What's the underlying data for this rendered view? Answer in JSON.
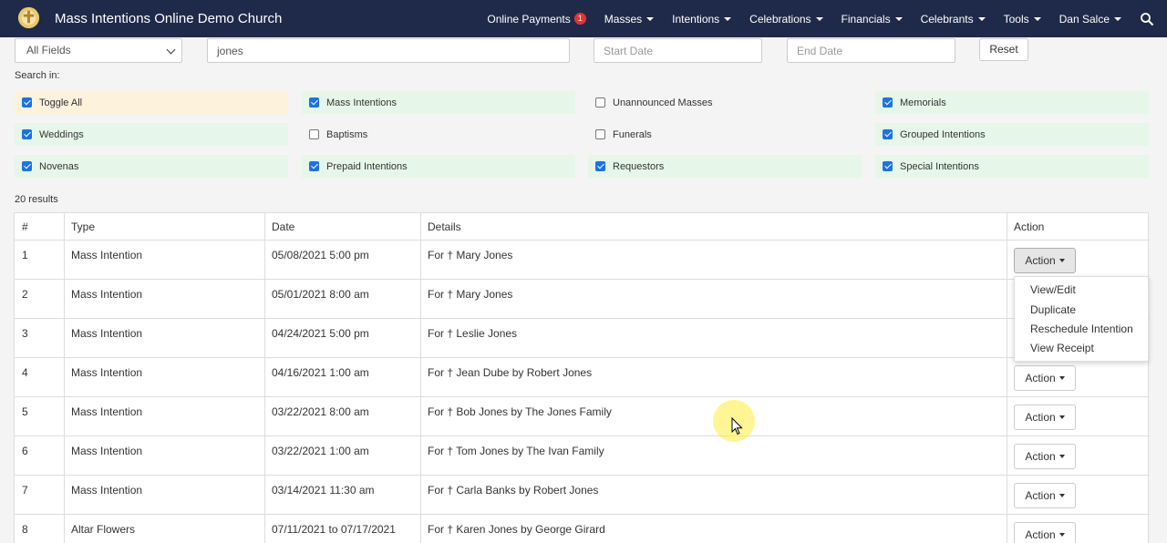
{
  "navbar": {
    "brand_title": "Mass Intentions Online Demo Church",
    "items": [
      {
        "label": "Online Payments",
        "badge": "1",
        "dropdown": false
      },
      {
        "label": "Masses",
        "dropdown": true
      },
      {
        "label": "Intentions",
        "dropdown": true
      },
      {
        "label": "Celebrations",
        "dropdown": true
      },
      {
        "label": "Financials",
        "dropdown": true
      },
      {
        "label": "Celebrants",
        "dropdown": true
      },
      {
        "label": "Tools",
        "dropdown": true
      },
      {
        "label": "Dan Salce",
        "dropdown": true
      }
    ]
  },
  "filters": {
    "field_select": "All Fields",
    "search_value": "jones",
    "start_date_placeholder": "Start Date",
    "end_date_placeholder": "End Date",
    "reset_label": "Reset",
    "search_in_label": "Search in:"
  },
  "categories": [
    {
      "label": "Toggle All",
      "checked": true
    },
    {
      "label": "Mass Intentions",
      "checked": true
    },
    {
      "label": "Unannounced Masses",
      "checked": false
    },
    {
      "label": "Memorials",
      "checked": true
    },
    {
      "label": "Weddings",
      "checked": true
    },
    {
      "label": "Baptisms",
      "checked": false
    },
    {
      "label": "Funerals",
      "checked": false
    },
    {
      "label": "Grouped Intentions",
      "checked": true
    },
    {
      "label": "Novenas",
      "checked": true
    },
    {
      "label": "Prepaid Intentions",
      "checked": true
    },
    {
      "label": "Requestors",
      "checked": true
    },
    {
      "label": "Special Intentions",
      "checked": true
    }
  ],
  "results_count": "20 results",
  "table": {
    "headers": [
      "#",
      "Type",
      "Date",
      "Details",
      "Action"
    ],
    "rows": [
      {
        "num": "1",
        "type": "Mass Intention",
        "date": "05/08/2021 5:00 pm",
        "details": "For † Mary Jones"
      },
      {
        "num": "2",
        "type": "Mass Intention",
        "date": "05/01/2021 8:00 am",
        "details": "For † Mary Jones"
      },
      {
        "num": "3",
        "type": "Mass Intention",
        "date": "04/24/2021 5:00 pm",
        "details": "For † Leslie Jones"
      },
      {
        "num": "4",
        "type": "Mass Intention",
        "date": "04/16/2021 1:00 am",
        "details": "For † Jean Dube by Robert Jones"
      },
      {
        "num": "5",
        "type": "Mass Intention",
        "date": "03/22/2021 8:00 am",
        "details": "For † Bob Jones by The Jones Family"
      },
      {
        "num": "6",
        "type": "Mass Intention",
        "date": "03/22/2021 1:00 am",
        "details": "For † Tom Jones by The Ivan Family"
      },
      {
        "num": "7",
        "type": "Mass Intention",
        "date": "03/14/2021 11:30 am",
        "details": "For † Carla Banks by Robert Jones"
      },
      {
        "num": "8",
        "type": "Altar Flowers",
        "date": "07/11/2021 to 07/17/2021",
        "details": "For † Karen Jones by George Girard"
      }
    ],
    "action_label": "Action"
  },
  "action_menu": [
    "View/Edit",
    "Duplicate",
    "Reschedule Intention",
    "View Receipt"
  ],
  "colors": {
    "navbar_bg": "#1f2a4a",
    "checked_bg": "#e6f7e9",
    "toggle_bg": "#fdf2dc",
    "badge": "#e3342f",
    "checkbox": "#1a73e8"
  }
}
